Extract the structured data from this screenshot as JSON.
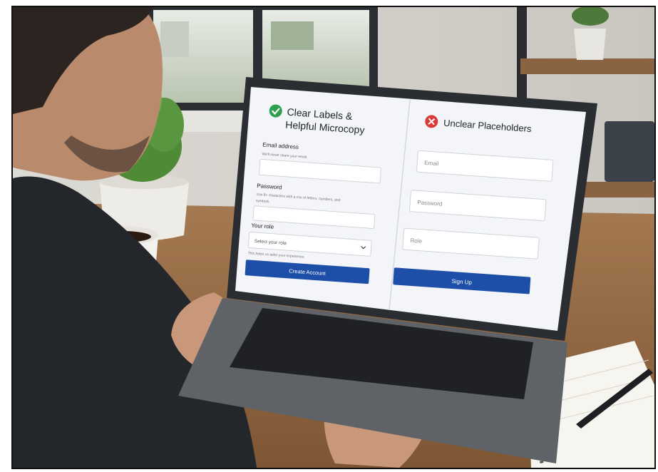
{
  "left_panel": {
    "heading_line1": "Clear Labels &",
    "heading_line2": "Helpful Microcopy",
    "email_label": "Email address",
    "email_help": "We'll never share your email.",
    "password_label": "Password",
    "password_help_line1": "Use 8+ characters with a mix of letters, numbers, and",
    "password_help_line2": "symbols.",
    "role_label": "Your role",
    "role_select_value": "Select your role",
    "role_help": "This helps us tailor your experience.",
    "submit_label": "Create Account"
  },
  "right_panel": {
    "heading": "Unclear Placeholders",
    "email_placeholder": "Email",
    "password_placeholder": "Password",
    "role_placeholder": "Role",
    "submit_label": "Sign Up"
  },
  "colors": {
    "good": "#2e9e4f",
    "bad": "#d93a3a",
    "button": "#1d4fa8"
  }
}
